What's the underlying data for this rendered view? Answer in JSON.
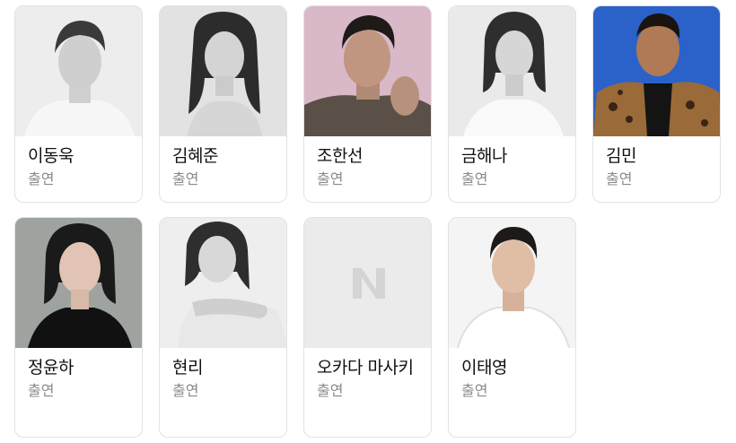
{
  "cast": [
    {
      "name": "이동욱",
      "role": "출연",
      "photo": "portrait-bw-man"
    },
    {
      "name": "김혜준",
      "role": "출연",
      "photo": "portrait-bw-woman"
    },
    {
      "name": "조한선",
      "role": "출연",
      "photo": "portrait-color-man-pink"
    },
    {
      "name": "금해나",
      "role": "출연",
      "photo": "portrait-bw-woman"
    },
    {
      "name": "김민",
      "role": "출연",
      "photo": "portrait-color-man-blue"
    },
    {
      "name": "정윤하",
      "role": "출연",
      "photo": "portrait-color-woman-gray"
    },
    {
      "name": "현리",
      "role": "출연",
      "photo": "portrait-bw-woman"
    },
    {
      "name": "오카다 마사키",
      "role": "출연",
      "photo": "placeholder-n-logo"
    },
    {
      "name": "이태영",
      "role": "출연",
      "photo": "portrait-color-man-white"
    }
  ],
  "placeholder_logo": "N",
  "colors": {
    "name_text": "#111111",
    "role_text": "#8a8a8a",
    "card_border": "#e2e2e2",
    "placeholder_bg": "#ebebeb",
    "placeholder_logo": "#d4d4d4"
  }
}
